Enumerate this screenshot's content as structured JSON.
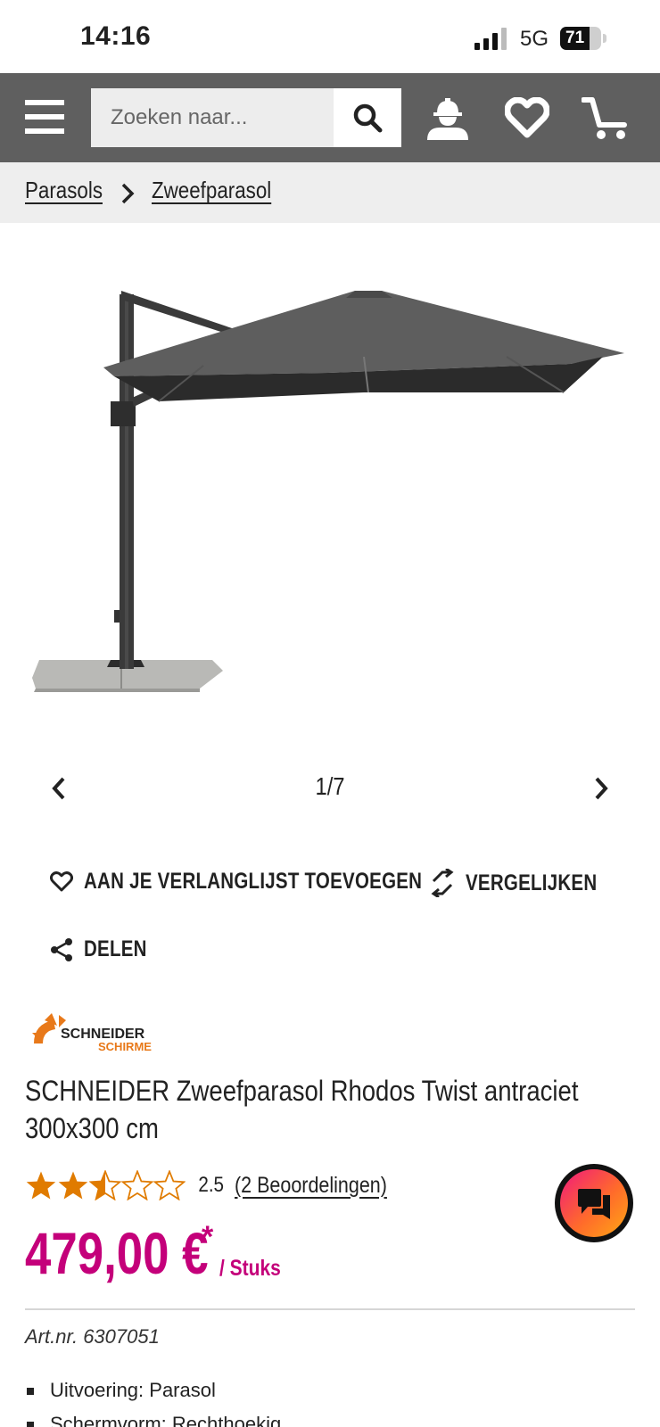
{
  "status_bar": {
    "time": "14:16",
    "network": "5G",
    "battery": "71",
    "battery_level": 0.71
  },
  "header": {
    "search_placeholder": "Zoeken naar...",
    "icons": [
      "menu-icon",
      "search-icon",
      "account-icon",
      "wishlist-heart-icon",
      "cart-icon"
    ]
  },
  "breadcrumb": {
    "items": [
      "Parasols",
      "Zweefparasol"
    ]
  },
  "gallery": {
    "counter": "1/7"
  },
  "actions": {
    "wishlist": "AAN JE VERLANGLIJST TOEVOEGEN",
    "compare": "VERGELIJKEN",
    "share": "DELEN"
  },
  "brand": {
    "name_line1": "SCHNEIDER",
    "name_line2": "SCHIRME"
  },
  "product": {
    "title": "SCHNEIDER Zweefparasol Rhodos Twist antraciet 300x300 cm",
    "rating_value": "2.5",
    "rating_stars": 2.5,
    "rating_max": 5,
    "reviews_link": "(2 Beoordelingen)",
    "price": "479,00 €",
    "price_star": "*",
    "price_unit": "/ Stuks",
    "art_nr": "Art.nr. 6307051",
    "specs": [
      "Uitvoering: Parasol",
      "Schermvorm: Rechthoekig"
    ]
  },
  "colors": {
    "header_bg": "#5f5f5f",
    "price": "#c4007a",
    "star": "#e07b00",
    "brand_orange": "#e8791a"
  }
}
